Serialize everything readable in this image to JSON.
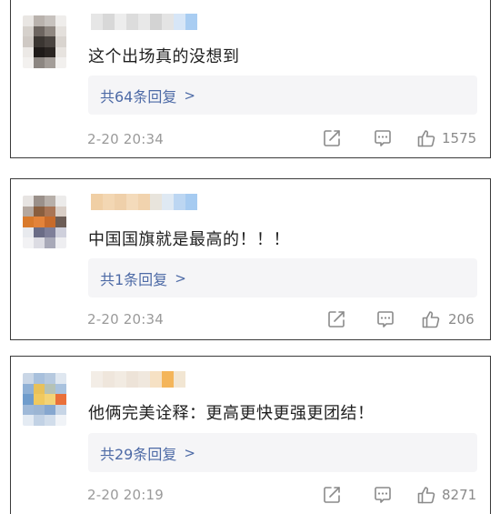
{
  "colors": {
    "reply_link": "#4d6aa6",
    "meta_text": "#9a9a9a",
    "reply_bg": "#f5f5f7"
  },
  "comments": [
    {
      "text": "这个出场真的没想到",
      "replies": "共64条回复",
      "reply_arrow": ">",
      "time": "2-20 20:34",
      "likes": "1575",
      "icons": [
        "share-icon",
        "comment-icon",
        "like-icon"
      ]
    },
    {
      "text": "中国国旗就是最高的！！！",
      "replies": "共1条回复",
      "reply_arrow": ">",
      "time": "2-20 20:34",
      "likes": "206",
      "icons": [
        "share-icon",
        "comment-icon",
        "like-icon"
      ]
    },
    {
      "text": "他俩完美诠释：更高更快更强更团结！",
      "replies": "共29条回复",
      "reply_arrow": ">",
      "time": "2-20 20:19",
      "likes": "8271",
      "icons": [
        "share-icon",
        "comment-icon",
        "like-icon"
      ]
    }
  ]
}
